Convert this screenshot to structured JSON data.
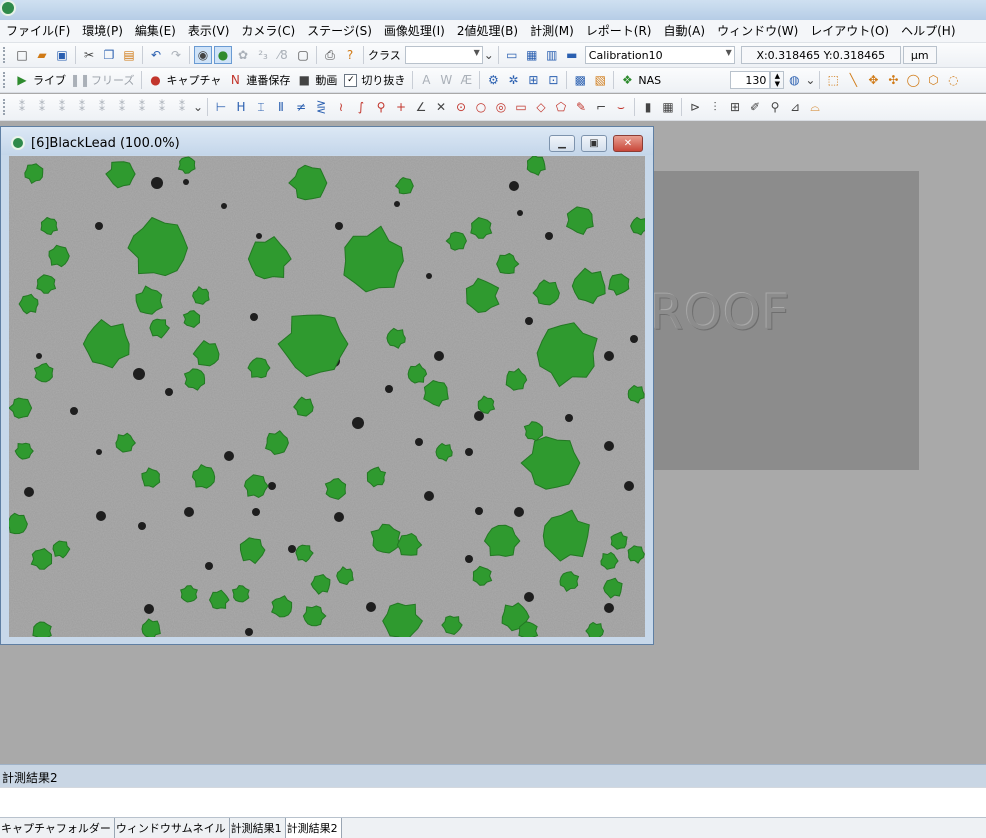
{
  "menu": [
    "ファイル(F)",
    "環境(P)",
    "編集(E)",
    "表示(V)",
    "カメラ(C)",
    "ステージ(S)",
    "画像処理(I)",
    "2値処理(B)",
    "計測(M)",
    "レポート(R)",
    "自動(A)",
    "ウィンドウ(W)",
    "レイアウト(O)",
    "ヘルプ(H)"
  ],
  "toolbar1": {
    "class_label": "クラス",
    "calibration": "Calibration10",
    "coords": "X:0.318465 Y:0.318465",
    "unit": "μm"
  },
  "toolbar2": {
    "live": "ライブ",
    "freeze": "フリーズ",
    "capture": "キャプチャ",
    "serial_save": "連番保存",
    "movie": "動画",
    "crop": "切り抜き",
    "nas": "NAS",
    "value": "130"
  },
  "image_window": {
    "title": "[6]BlackLead (100.0%)"
  },
  "watermark": "ROOF",
  "results": {
    "title": "計測結果2"
  },
  "tabs": [
    "キャプチャフォルダー",
    "ウィンドウサムネイル",
    "計測結果1",
    "計測結果2"
  ],
  "active_tab": 3,
  "colors": {
    "particle": "#2f9a2f",
    "sample_bg": "#9a9a9a"
  }
}
